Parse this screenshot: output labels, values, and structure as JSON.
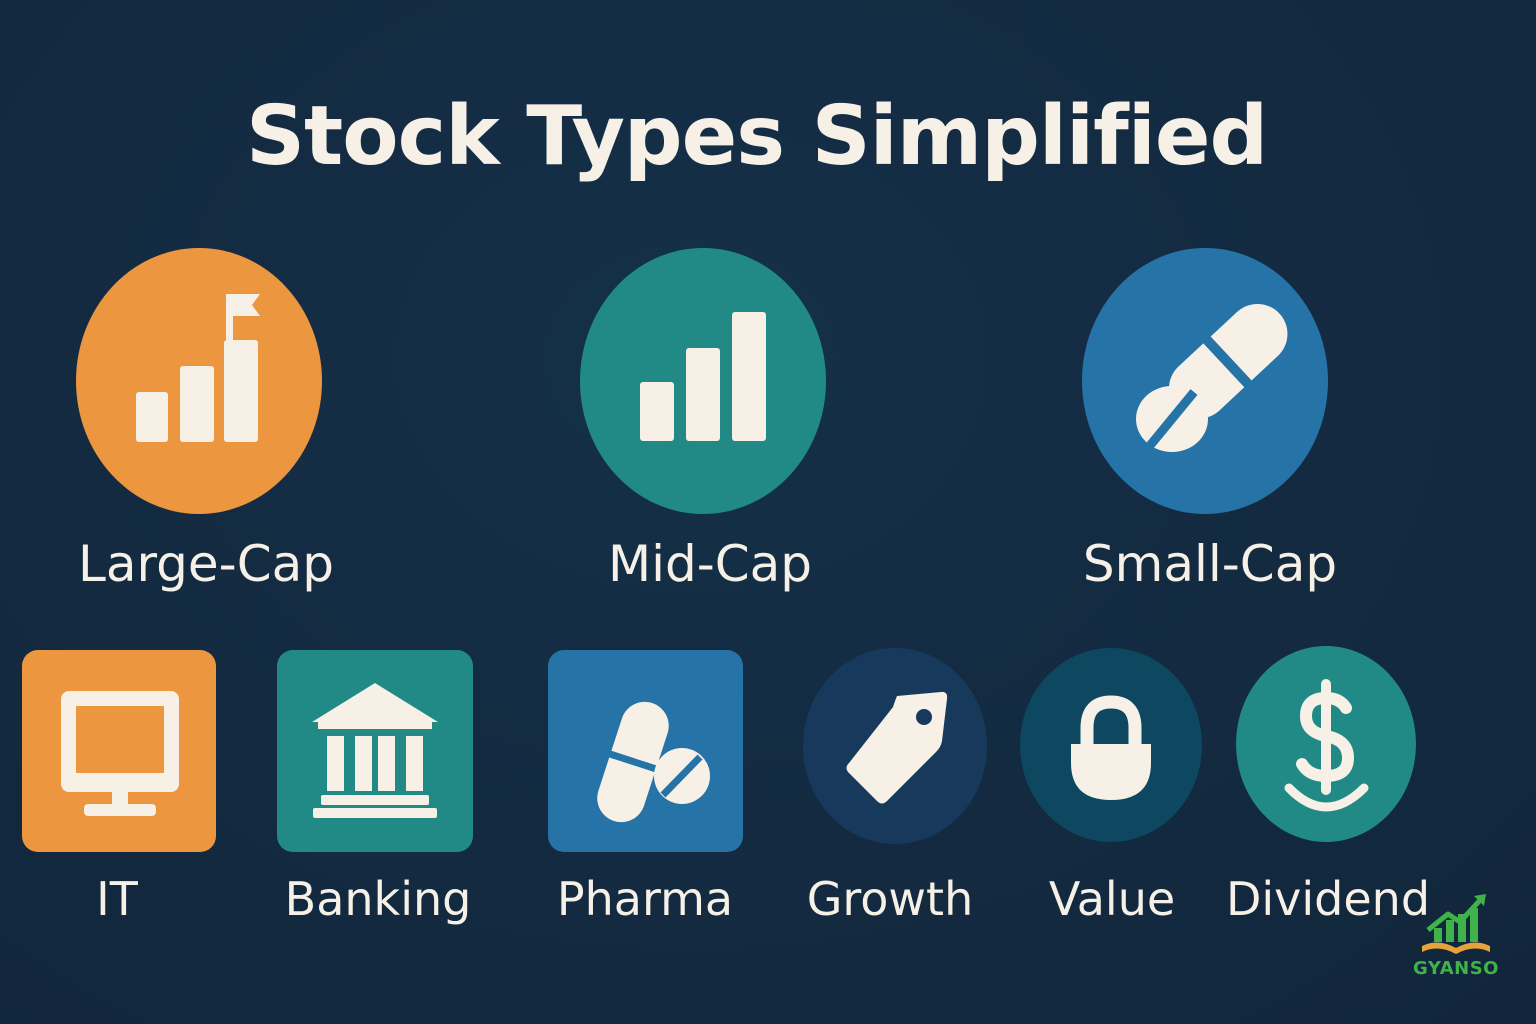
{
  "title": "Stock Types Simplified",
  "colors": {
    "background": "#132a40",
    "text": "#f6f0e6",
    "orange": "#ec963f",
    "teal": "#218a86",
    "blue": "#2673a8",
    "navy": "#173a5c",
    "dark_teal": "#0e4760",
    "logo_green": "#3fb24a"
  },
  "caps": [
    {
      "label": "Large-Cap",
      "icon": "bar-chart-flag-icon",
      "color": "#ec963f"
    },
    {
      "label": "Mid-Cap",
      "icon": "bar-chart-icon",
      "color": "#218a86"
    },
    {
      "label": "Small-Cap",
      "icon": "pill-icon",
      "color": "#2673a8"
    }
  ],
  "sectors": [
    {
      "label": "IT",
      "icon": "monitor-icon",
      "color": "#ec963f"
    },
    {
      "label": "Banking",
      "icon": "bank-icon",
      "color": "#218a86"
    },
    {
      "label": "Pharma",
      "icon": "pills-icon",
      "color": "#2673a8"
    },
    {
      "label": "Growth",
      "icon": "price-tag-icon",
      "color": "#173a5c"
    },
    {
      "label": "Value",
      "icon": "padlock-icon",
      "color": "#0e4760"
    },
    {
      "label": "Dividend",
      "icon": "dollar-hand-icon",
      "color": "#218a86"
    }
  ],
  "logo": {
    "text": "GYANSO",
    "icon": "growth-book-logo-icon"
  }
}
